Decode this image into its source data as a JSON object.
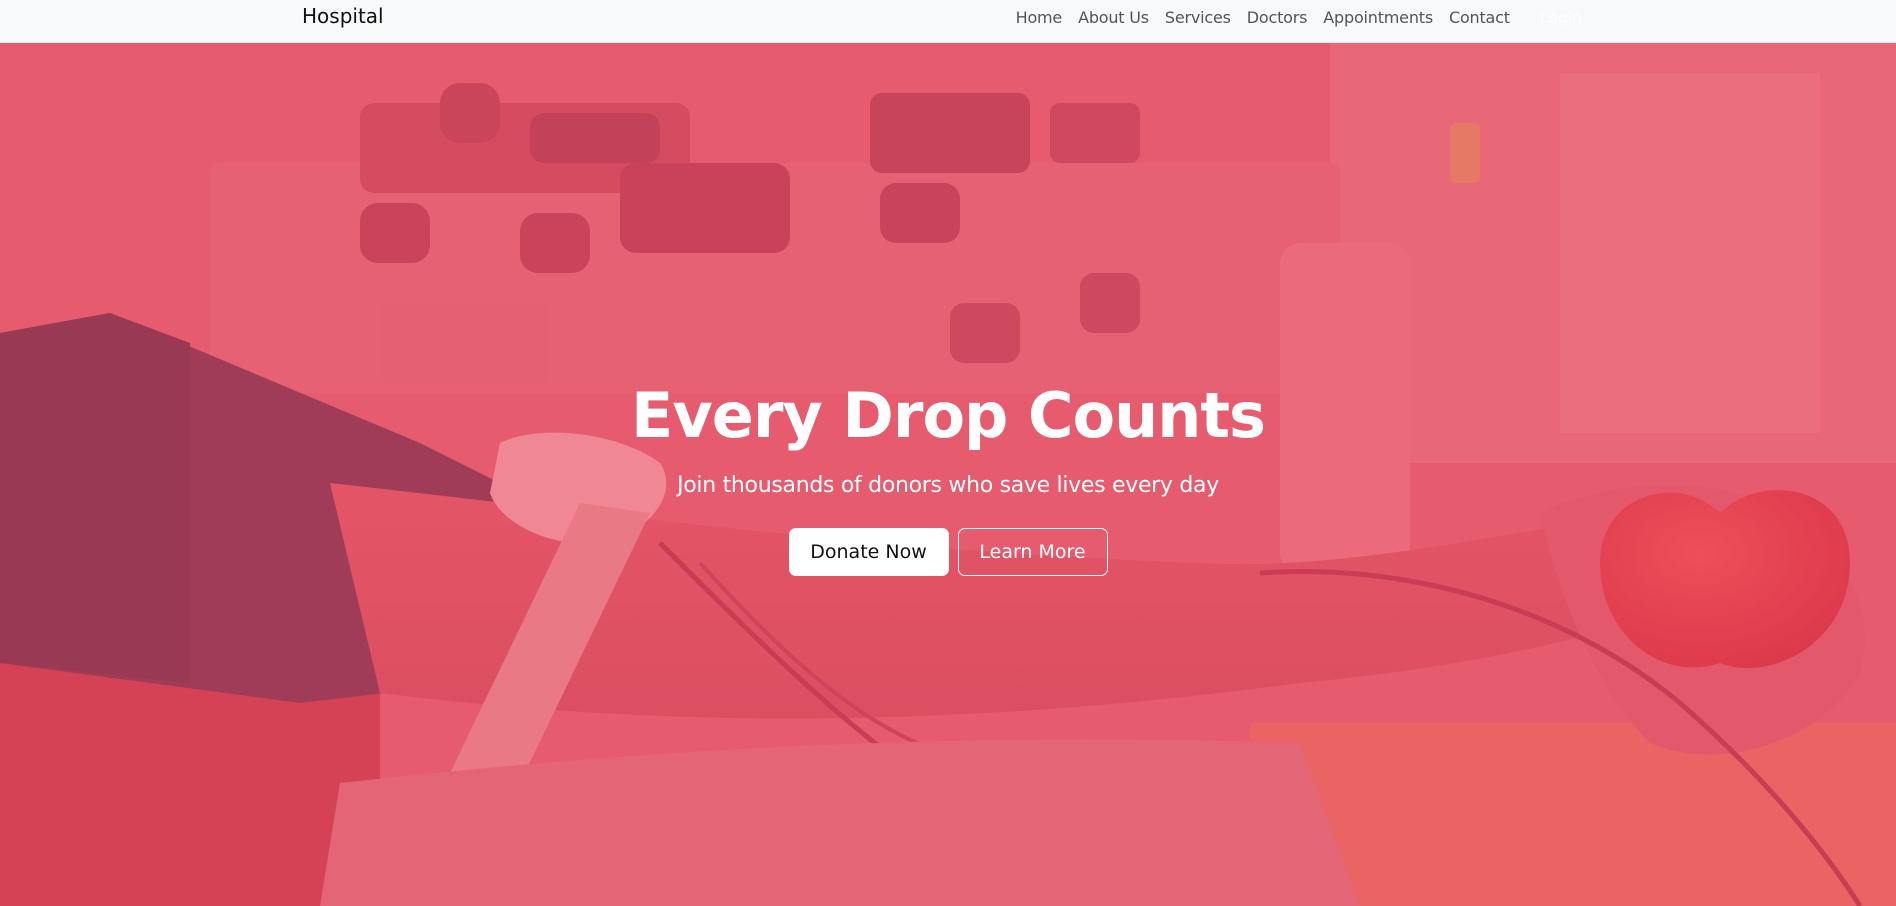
{
  "navbar": {
    "brand": "Hospital",
    "links": [
      {
        "label": "Home"
      },
      {
        "label": "About Us"
      },
      {
        "label": "Services"
      },
      {
        "label": "Doctors"
      },
      {
        "label": "Appointments"
      },
      {
        "label": "Contact"
      },
      {
        "label": "Login"
      }
    ]
  },
  "hero": {
    "title": "Every Drop Counts",
    "subtitle": "Join thousands of donors who save lives every day",
    "primary_button": "Donate Now",
    "secondary_button": "Learn More",
    "overlay_color": "#e15a6a"
  },
  "colors": {
    "navbar_bg": "#f8f9fa",
    "accent": "#e15a6a"
  }
}
